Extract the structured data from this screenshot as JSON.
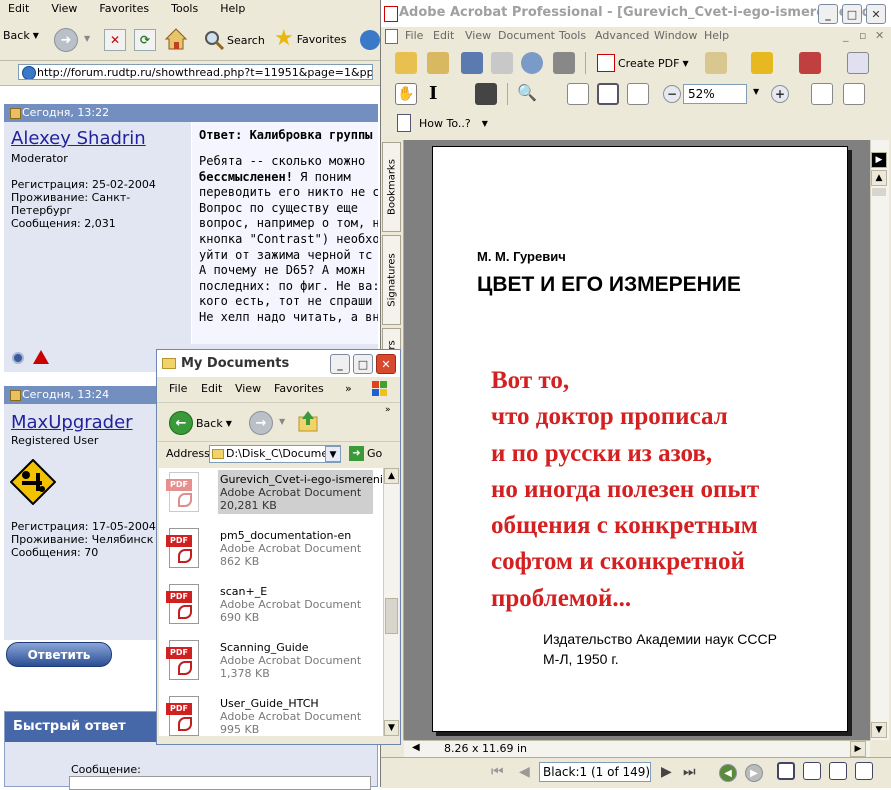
{
  "ie": {
    "menu": [
      "Edit",
      "View",
      "Favorites",
      "Tools",
      "Help"
    ],
    "back_label": "Back",
    "search_label": "Search",
    "favorites_label": "Favorites",
    "address": "http://forum.rudtp.ru/showthread.php?t=11951&page=1&pp=20",
    "posts": [
      {
        "time": "Сегодня, 13:22",
        "username": "Alexey Shadrin",
        "rank": "Moderator",
        "info": [
          "Регистрация: 25-02-2004",
          "Проживание: Санкт-",
          "Петербург",
          "Сообщения: 2,031"
        ],
        "title": "Ответ: Калибровка группы",
        "body": [
          {
            "text": "Ребята -- сколько можно",
            "bold": ""
          },
          {
            "text": " Я поним",
            "bold": "бессмысленен!"
          },
          {
            "text": "переводить его никто не с",
            "bold": ""
          },
          {
            "text": "Вопрос по существу еще",
            "bold": ""
          },
          {
            "text": "вопрос, например о том, н",
            "bold": ""
          },
          {
            "text": "кнопка \"Contrast\") необхо",
            "bold": ""
          },
          {
            "text": "уйти от зажима черной тс",
            "bold": ""
          },
          {
            "text": "А почему не D65? А можн",
            "bold": ""
          },
          {
            "text": "последних: по фиг. Не ва:",
            "bold": ""
          },
          {
            "text": "кого есть, тот не спраши",
            "bold": ""
          },
          {
            "text": "Не хелп надо читать, а вн",
            "bold": ""
          }
        ]
      },
      {
        "time": "Сегодня, 13:24",
        "username": "MaxUpgrader",
        "rank": "Registered User",
        "info": [
          "Регистрация: 17-05-2004",
          "Проживание: Челябинск",
          "Сообщения: 70"
        ]
      }
    ],
    "reply_button": "Ответить",
    "quick_reply": {
      "title": "Быстрый ответ",
      "message_label": "Сообщение:"
    }
  },
  "acrobat": {
    "title": "Adobe Acrobat Professional - [Gurevich_Cvet-i-ego-ismerenie.pdf]",
    "menu": [
      "File",
      "Edit",
      "View",
      "Document",
      "Tools",
      "Advanced",
      "Window",
      "Help"
    ],
    "create_pdf": "Create PDF",
    "zoom": "52%",
    "how_to": "How To..?",
    "side_tabs": [
      "Bookmarks",
      "Signatures",
      "ers"
    ],
    "page_size": "8.26 x 11.69 in",
    "page_field": "Black:1",
    "page_count": "(1 of 149)",
    "document": {
      "author": "М. М. Гуревич",
      "title": "ЦВЕТ И ЕГО ИЗМЕРЕНИЕ",
      "note": [
        "Вот то,",
        "что доктор прописал",
        "и по русски из азов,",
        "но иногда полезен опыт",
        "общения с конкретным",
        "софтом и сконкретной",
        "проблемой..."
      ],
      "publisher": [
        "Издательство Академии наук СССР",
        "М-Л, 1950 г."
      ],
      "note_color": "#d42020"
    }
  },
  "explorer": {
    "title": "My Documents",
    "menu": [
      "File",
      "Edit",
      "View",
      "Favorites"
    ],
    "back_label": "Back",
    "address_label": "Address",
    "address": "D:\\Disk_C\\Docume",
    "go_label": "Go",
    "files": [
      {
        "name": "Gurevich_Cvet-i-ego-ismerenie",
        "type": "Adobe Acrobat Document",
        "size": "20,281 KB",
        "selected": true
      },
      {
        "name": "pm5_documentation-en",
        "type": "Adobe Acrobat Document",
        "size": "862 KB"
      },
      {
        "name": "scan+_E",
        "type": "Adobe Acrobat Document",
        "size": "690 KB"
      },
      {
        "name": "Scanning_Guide",
        "type": "Adobe Acrobat Document",
        "size": "1,378 KB"
      },
      {
        "name": "User_Guide_HTCH",
        "type": "Adobe Acrobat Document",
        "size": "995 KB"
      }
    ]
  }
}
